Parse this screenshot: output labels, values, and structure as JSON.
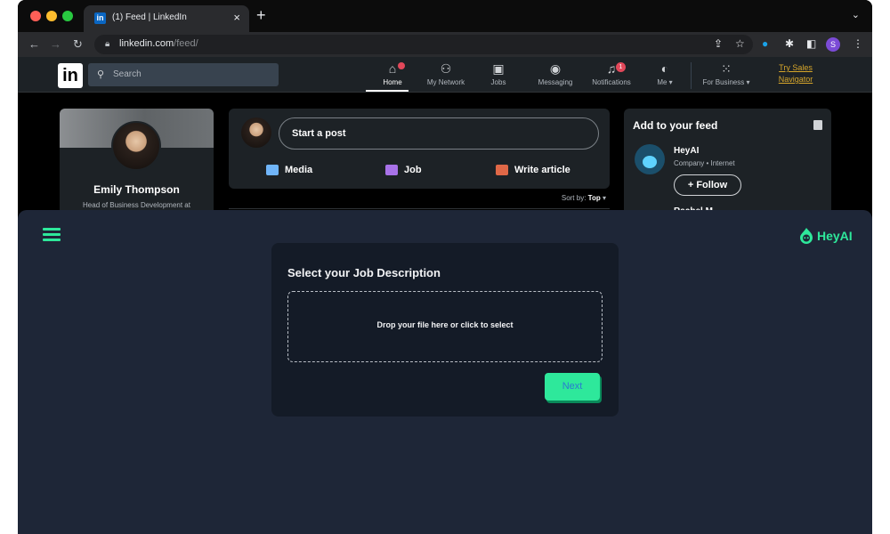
{
  "browser": {
    "tab_title": "(1) Feed | LinkedIn",
    "tab_favicon": "in",
    "url_domain": "linkedin.com",
    "url_path": "/feed/",
    "profile_initial": "S"
  },
  "linkedin": {
    "logo": "in",
    "search_placeholder": "Search",
    "nav": {
      "home": "Home",
      "home_badge": "",
      "network": "My Network",
      "jobs": "Jobs",
      "messaging": "Messaging",
      "notifications": "Notifications",
      "notifications_badge": "1",
      "me": "Me ▾",
      "business": "For Business ▾",
      "try_sales_line1": "Try Sales",
      "try_sales_line2": "Navigator"
    },
    "profile": {
      "name": "Emily Thompson",
      "headline": "Head of Business Development at"
    },
    "post_box": {
      "start_post": "Start a post",
      "media": "Media",
      "job": "Job",
      "write_article": "Write article"
    },
    "sort": {
      "label": "Sort by:",
      "value": "Top"
    },
    "add_feed": {
      "title": "Add to your feed",
      "company_name": "HeyAI",
      "company_meta": "Company • Internet",
      "follow_label": "+ Follow",
      "next_name": "Rachel M..."
    }
  },
  "heyai": {
    "brand": "HeyAI",
    "card_title": "Select your Job Description",
    "dropzone_text": "Drop your file here or click to select",
    "next_button": "Next"
  },
  "colors": {
    "accent": "#2ee89b",
    "overlay_bg": "#1e2637",
    "card_bg": "#141b27",
    "linkedin_surface": "#1d2226"
  },
  "icons": {
    "back": "arrow-left-icon",
    "forward": "arrow-right-icon",
    "reload": "reload-icon",
    "lock": "lock-icon",
    "share": "share-icon",
    "star": "star-icon",
    "extension": "heyai-extension-icon",
    "puzzle": "puzzle-icon",
    "sidepanel": "sidepanel-icon",
    "kebab": "kebab-icon",
    "menu": "hamburger-icon"
  }
}
